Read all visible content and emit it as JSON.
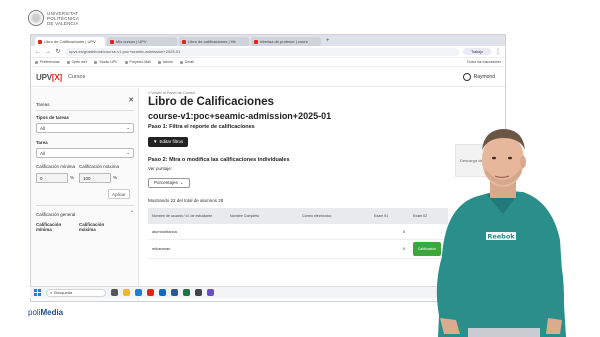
{
  "logo": {
    "line1": "UNIVERSITAT",
    "line2": "POLITÈCNICA",
    "line3": "DE VALÈNCIA"
  },
  "browser": {
    "tabs": [
      {
        "label": "Libro de Calificaciones | UPV"
      },
      {
        "label": "Mis cursos | UPV"
      },
      {
        "label": "Libro de calificaciones | Hit"
      },
      {
        "label": "Interfaz de profesor | cours"
      }
    ],
    "new_tab": "+",
    "url": "upvx.es/gradebook/course-v1:poc+seamic-admission+2025-01",
    "profile_label": "Trabajo",
    "bookmarks": [
      "Preferencias",
      "Open edX",
      "Studio UPV",
      "Proyecto Mail",
      "Admin",
      "Gmail"
    ],
    "bookmarks_right": "Todos los marcadores"
  },
  "app": {
    "brand_upv": "UPV",
    "brand_x": "[X]",
    "nav_courses": "Cursos",
    "username": "Raymond"
  },
  "sidebar": {
    "section_tasks": "Tareas",
    "task_type_label": "Tipos de tareas",
    "task_type_value": "All",
    "task_label": "Tarea",
    "task_value": "All",
    "min_label": "Calificación mínima",
    "max_label": "Calificación máxima",
    "min_value": "0",
    "max_value": "100",
    "pct": "%",
    "apply": "Aplicar",
    "section_overall": "Calificación general",
    "overall_min_label": "Calificación mínima",
    "overall_max_label": "Calificación máxima"
  },
  "main": {
    "breadcrumb": "« Volver al Panel de Control",
    "title": "Libro de Calificaciones",
    "course": "course-v1:poc+seamic-admission+2025-01",
    "step1": "Paso 1: Filtra el reporte de calificaciones",
    "edit_filters": "Editar filtros",
    "step2": "Paso 2: Mira o modifica las calificaciones individuales",
    "see_label": "Ver puntaje:",
    "see_value": "Porcentajes",
    "showing": "Mostrando 22 del total de alumnos 28",
    "columns": [
      "Nombre de usuario / Id. de estudiante",
      "Nombre Completo",
      "Correo electrónico",
      "Exam 01",
      "Exam 02"
    ],
    "rows": [
      {
        "username": "alumnoblanca",
        "exam1": "0",
        "exam2": ""
      },
      {
        "username": "mikamnan",
        "exam1": "0",
        "exam2": ""
      }
    ],
    "row_action": "Calificación"
  },
  "side_note": "Descarga de notas",
  "taskbar": {
    "search": "Búsqueda"
  },
  "footer": {
    "brand_a": "poli",
    "brand_b": "Media"
  },
  "colors": {
    "accent": "#e2241a",
    "success": "#3ba83b",
    "dark": "#222222"
  }
}
